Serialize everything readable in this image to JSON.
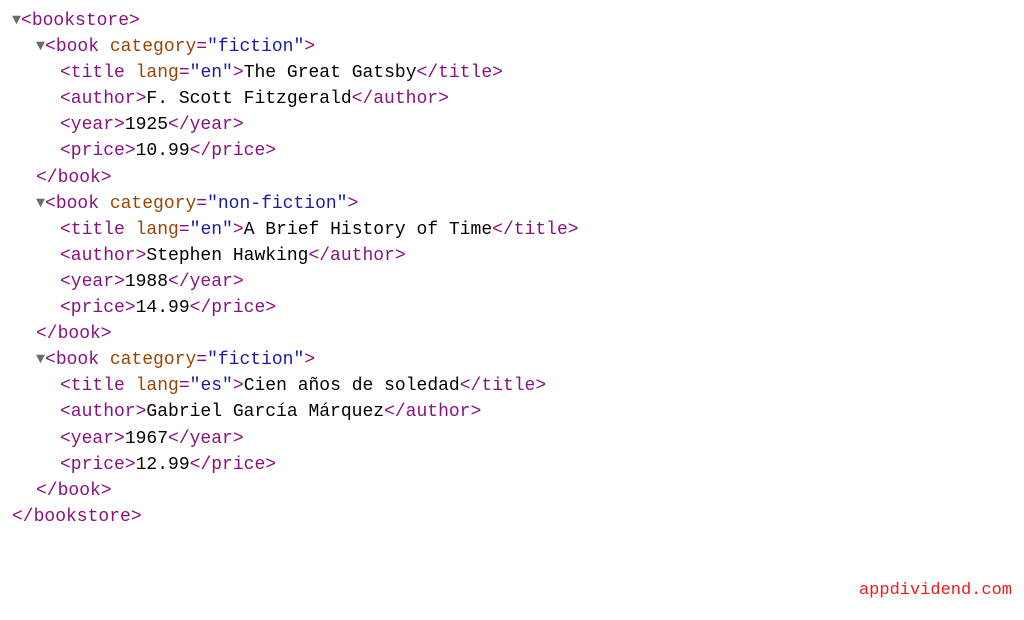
{
  "root": {
    "open": "<bookstore>",
    "close": "</bookstore>"
  },
  "books": [
    {
      "book_open_prefix": "<book ",
      "book_attr_name": "category",
      "book_attr_value": "\"fiction\"",
      "book_open_suffix": ">",
      "title_open_prefix": "<title ",
      "title_attr_name": "lang",
      "title_attr_value": "\"en\"",
      "title_open_suffix": ">",
      "title_text": "The Great Gatsby",
      "title_close": "</title>",
      "author_open": "<author>",
      "author_text": "F. Scott Fitzgerald",
      "author_close": "</author>",
      "year_open": "<year>",
      "year_text": "1925",
      "year_close": "</year>",
      "price_open": "<price>",
      "price_text": "10.99",
      "price_close": "</price>",
      "book_close": "</book>"
    },
    {
      "book_open_prefix": "<book ",
      "book_attr_name": "category",
      "book_attr_value": "\"non-fiction\"",
      "book_open_suffix": ">",
      "title_open_prefix": "<title ",
      "title_attr_name": "lang",
      "title_attr_value": "\"en\"",
      "title_open_suffix": ">",
      "title_text": "A Brief History of Time",
      "title_close": "</title>",
      "author_open": "<author>",
      "author_text": "Stephen Hawking",
      "author_close": "</author>",
      "year_open": "<year>",
      "year_text": "1988",
      "year_close": "</year>",
      "price_open": "<price>",
      "price_text": "14.99",
      "price_close": "</price>",
      "book_close": "</book>"
    },
    {
      "book_open_prefix": "<book ",
      "book_attr_name": "category",
      "book_attr_value": "\"fiction\"",
      "book_open_suffix": ">",
      "title_open_prefix": "<title ",
      "title_attr_name": "lang",
      "title_attr_value": "\"es\"",
      "title_open_suffix": ">",
      "title_text": "Cien años de soledad",
      "title_close": "</title>",
      "author_open": "<author>",
      "author_text": "Gabriel García Márquez",
      "author_close": "</author>",
      "year_open": "<year>",
      "year_text": "1967",
      "year_close": "</year>",
      "price_open": "<price>",
      "price_text": "12.99",
      "price_close": "</price>",
      "book_close": "</book>"
    }
  ],
  "equals": "=",
  "arrow": "▼",
  "watermark": "appdividend.com"
}
